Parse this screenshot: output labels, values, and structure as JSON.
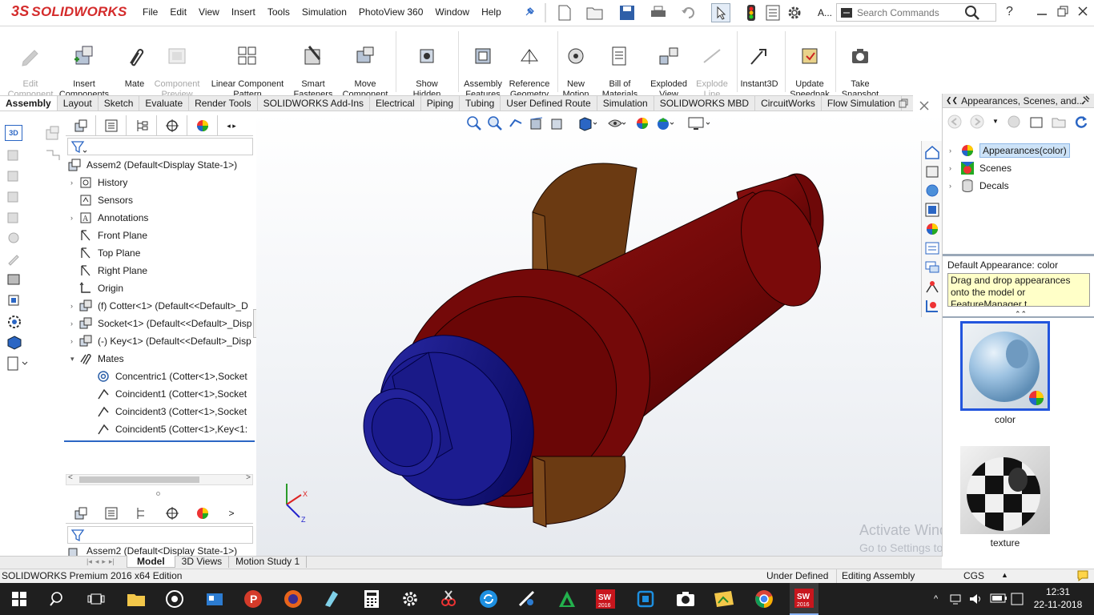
{
  "app": {
    "logo": "SOLIDWORKS",
    "logo_prefix": "3S"
  },
  "menu": [
    "File",
    "Edit",
    "View",
    "Insert",
    "Tools",
    "Simulation",
    "PhotoView 360",
    "Window",
    "Help"
  ],
  "search": {
    "placeholder": "Search Commands"
  },
  "titlebar_extra": "A...",
  "commands": [
    {
      "label": "Edit\nComponent",
      "disabled": true
    },
    {
      "label": "Insert\nComponents"
    },
    {
      "label": "Mate"
    },
    {
      "label": "Component\nPreview\nWindow",
      "disabled": true
    },
    {
      "label": "Linear Component\nPattern"
    },
    {
      "label": "Smart\nFasteners"
    },
    {
      "label": "Move\nComponent"
    },
    {
      "label": "Show\nHidden\nComponents"
    },
    {
      "label": "Assembly\nFeatures"
    },
    {
      "label": "Reference\nGeometry"
    },
    {
      "label": "New\nMotion\nStudy"
    },
    {
      "label": "Bill of\nMaterials"
    },
    {
      "label": "Exploded\nView"
    },
    {
      "label": "Explode\nLine\nSketch",
      "disabled": true
    },
    {
      "label": "Instant3D"
    },
    {
      "label": "Update\nSpeedpak"
    },
    {
      "label": "Take\nSnapshot"
    }
  ],
  "tabs": [
    "Assembly",
    "Layout",
    "Sketch",
    "Evaluate",
    "Render Tools",
    "SOLIDWORKS Add-Ins",
    "Electrical",
    "Piping",
    "Tubing",
    "User Defined Route",
    "Simulation",
    "SOLIDWORKS MBD",
    "CircuitWorks",
    "Flow Simulation"
  ],
  "active_tab": "Assembly",
  "tree": {
    "root": "Assem2  (Default<Display State-1>)",
    "items": [
      {
        "label": "History",
        "expandable": true
      },
      {
        "label": "Sensors",
        "expandable": false
      },
      {
        "label": "Annotations",
        "expandable": true
      },
      {
        "label": "Front Plane",
        "expandable": false
      },
      {
        "label": "Top Plane",
        "expandable": false
      },
      {
        "label": "Right Plane",
        "expandable": false
      },
      {
        "label": "Origin",
        "expandable": false
      },
      {
        "label": "(f) Cotter<1> (Default<<Default>_D",
        "expandable": true
      },
      {
        "label": "Socket<1> (Default<<Default>_Disp",
        "expandable": true
      },
      {
        "label": "(-) Key<1> (Default<<Default>_Disp",
        "expandable": true
      },
      {
        "label": "Mates",
        "expandable": true,
        "expanded": true
      },
      {
        "label": "Concentric1 (Cotter<1>,Socket",
        "expandable": false
      },
      {
        "label": "Coincident1 (Cotter<1>,Socket",
        "expandable": false
      },
      {
        "label": "Coincident3 (Cotter<1>,Socket",
        "expandable": false
      },
      {
        "label": "Coincident5 (Cotter<1>,Key<1:",
        "expandable": false
      }
    ],
    "bottom_root": "Assem2  (Default<Display State-1>)"
  },
  "bottom_tabs": [
    "Model",
    "3D Views",
    "Motion Study 1"
  ],
  "active_bottom_tab": "Model",
  "taskpane": {
    "title": "Appearances, Scenes, and...",
    "items": [
      "Appearances(color)",
      "Scenes",
      "Decals"
    ],
    "info_title": "Default Appearance: color",
    "tooltip": "Drag and drop appearances onto the model or FeatureManager t...",
    "swatches": [
      "color",
      "texture"
    ]
  },
  "watermark": {
    "line1": "Activate Windows",
    "line2": "Go to Settings to activate Windows."
  },
  "status": {
    "left": "SOLIDWORKS Premium 2016 x64 Edition",
    "defined": "Under Defined",
    "mode": "Editing Assembly",
    "units": "CGS"
  },
  "clock": {
    "time": "12:31",
    "date": "22-11-2018"
  },
  "colors": {
    "model_red": "#7a0a0a",
    "model_blue": "#1a1a8c",
    "model_brown": "#6b3a12",
    "accent": "#0070c0"
  }
}
